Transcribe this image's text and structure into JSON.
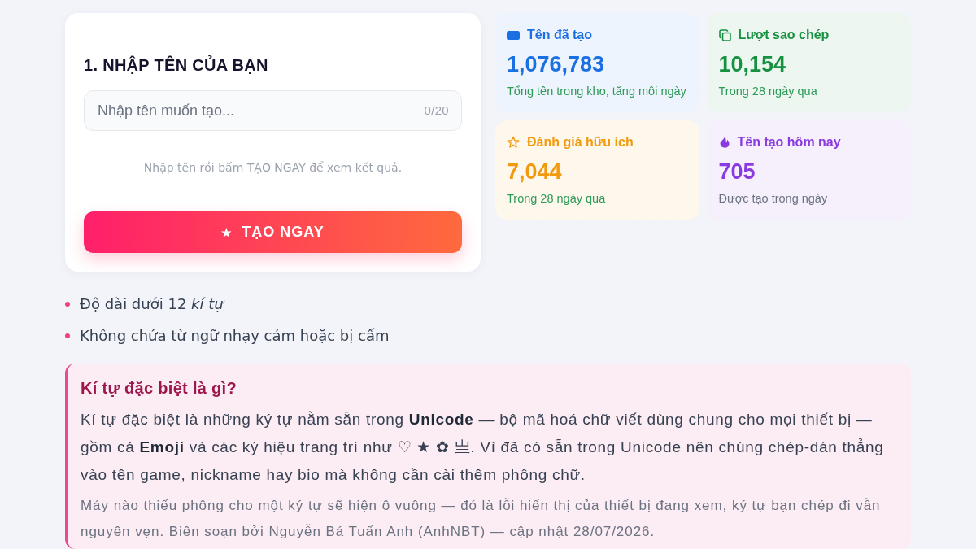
{
  "input_card": {
    "title": "1. NHẬP TÊN CỦA BẠN",
    "name_field": {
      "placeholder": "Nhập tên muốn tạo...",
      "counter": "0/20"
    },
    "hint": "Nhập tên rồi bấm TẠO NGAY để xem kết quả.",
    "create_button": {
      "icon": "★",
      "label": "TẠO NGAY"
    }
  },
  "stats": [
    {
      "label": "Tên đã tạo",
      "value": "1,076,783",
      "note": {
        "text": "Tổng tên trong kho, tăng mỗi ngày",
        "color": "#2e9a57"
      },
      "color": "#1a6fe3"
    },
    {
      "label": "Lượt sao chép",
      "value": "10,154",
      "note": {
        "text": "Trong 28 ngày qua",
        "color": "#2e9a57"
      },
      "color": "#16913f"
    },
    {
      "label": "Đánh giá hữu ích",
      "value": "7,044",
      "note": {
        "text": "Trong 28 ngày qua",
        "color": "#2e9a57"
      },
      "color": "#f29a0e"
    },
    {
      "label": "Tên tạo hôm nay",
      "value": "705",
      "note": {
        "text": "Được tạo trong ngày",
        "color": "#6b7280"
      },
      "color": "#8a3be0"
    }
  ],
  "rules": [
    "Độ dài dưới 12 *kí tự*",
    "Không chứa từ ngữ nhạy cảm hoặc bị cấm"
  ],
  "info_box": {
    "title": "Kí tự đặc biệt là gì?",
    "body": "Kí tự đặc biệt là những ký tự nằm sẵn trong **Unicode** — bộ mã hoá chữ viết dùng chung cho mọi thiết bị — gồm cả **Emoji** và các ký hiệu trang trí như ♡ ★ ✿ 亗. Vì đã có sẵn trong Unicode nên chúng chép-dán thẳng vào tên game, nickname hay bio mà không cần cài thêm phông chữ.",
    "note": "Máy nào thiếu phông cho một ký tự sẽ hiện ô vuông — đó là lỗi hiển thị của thiết bị đang xem, ký tự bạn chép đi vẫn nguyên vẹn. Biên soạn bởi Nguyễn Bá Tuấn Anh (AnhNBT) — cập nhật 28/07/2026."
  }
}
